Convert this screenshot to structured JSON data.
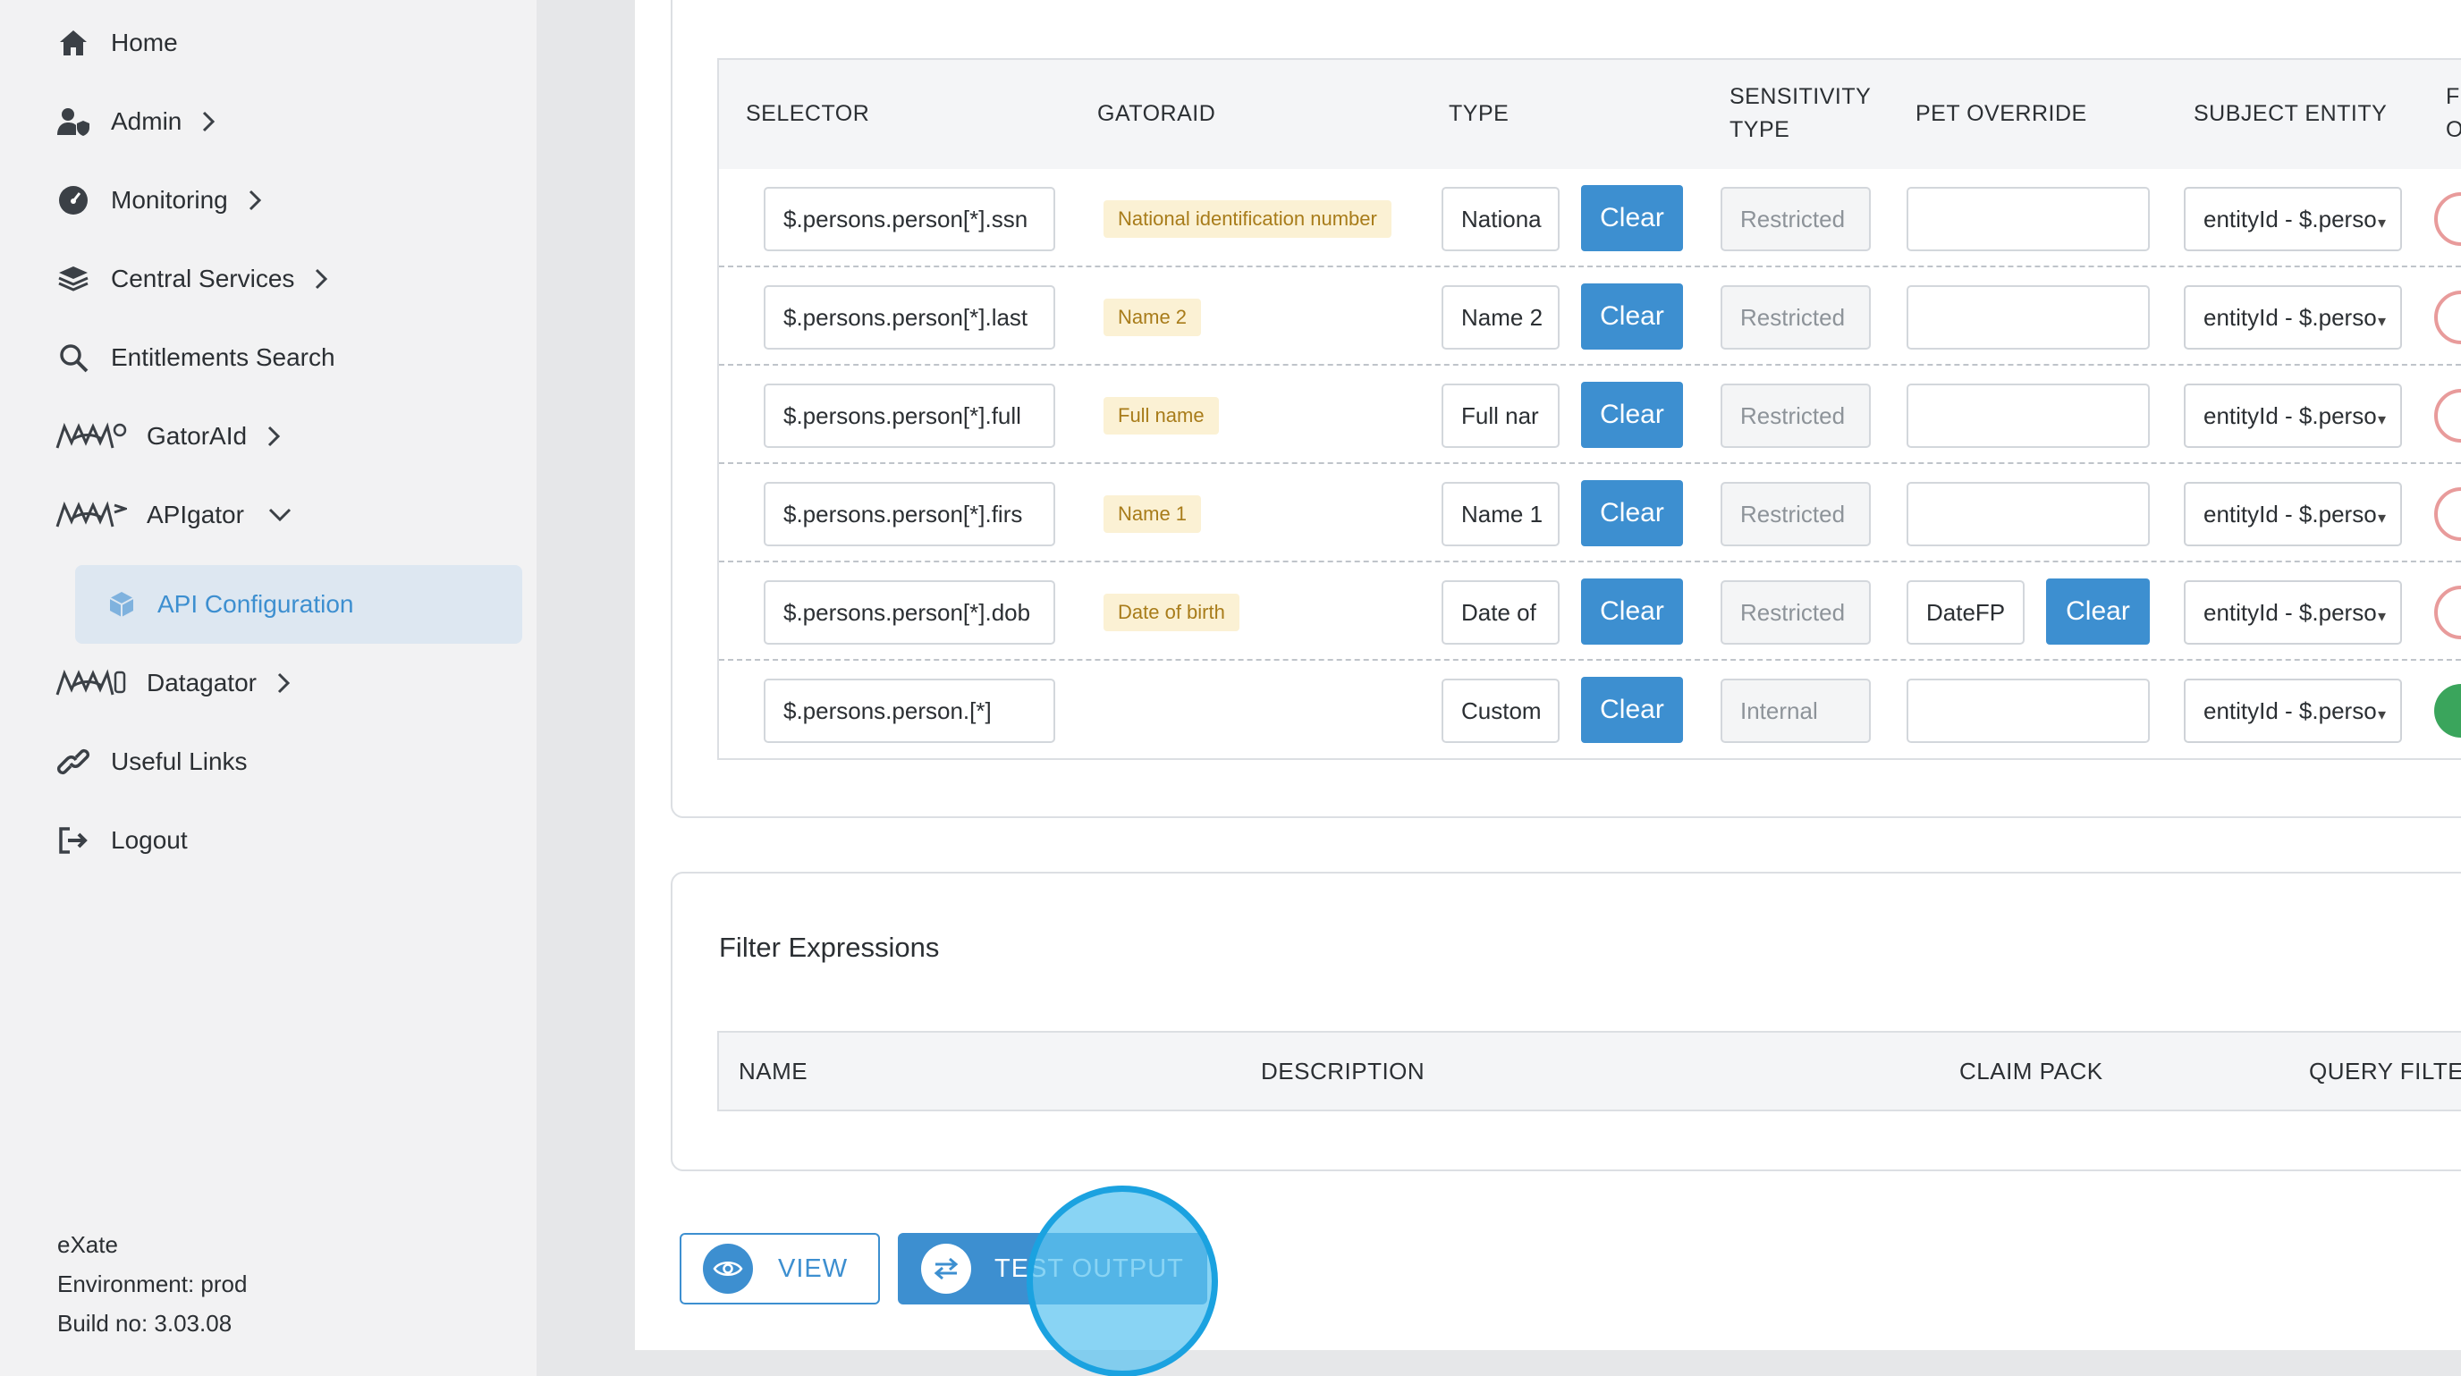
{
  "sidebar": {
    "items": [
      {
        "label": "Home",
        "icon": "home-icon"
      },
      {
        "label": "Admin",
        "icon": "user-shield-icon"
      },
      {
        "label": "Monitoring",
        "icon": "gauge-icon"
      },
      {
        "label": "Central Services",
        "icon": "layers-icon"
      },
      {
        "label": "Entitlements Search",
        "icon": "search-icon"
      },
      {
        "label": "GatorAId",
        "icon": "gator-icon"
      },
      {
        "label": "APIgator",
        "icon": "gator-icon"
      },
      {
        "label": "Datagator",
        "icon": "gator-icon"
      },
      {
        "label": "Useful Links",
        "icon": "link-icon"
      },
      {
        "label": "Logout",
        "icon": "logout-icon"
      }
    ],
    "active_sub_item": {
      "label": "API Configuration",
      "icon": "cube-icon"
    },
    "footer": {
      "company": "eXate",
      "environment": "Environment: prod",
      "build": "Build no: 3.03.08"
    }
  },
  "selectors_table": {
    "headers": {
      "selector": "SELECTOR",
      "gatoraid": "GATORAID",
      "type": "TYPE",
      "sensitivity_line1": "SENSITIVITY",
      "sensitivity_line2": "TYPE",
      "pet_override": "PET OVERRIDE",
      "subject_entity": "SUBJECT ENTITY",
      "cut_line1": "FI",
      "cut_line2": "O"
    },
    "clear_label": "Clear",
    "rows": [
      {
        "selector": "$.persons.person[*].ssn",
        "gatoraid": "National identification number",
        "type": "Nationa",
        "sensitivity": "Restricted",
        "pet": "",
        "subject": "entityId - $.perso"
      },
      {
        "selector": "$.persons.person[*].last",
        "gatoraid": "Name 2",
        "type": "Name 2",
        "sensitivity": "Restricted",
        "pet": "",
        "subject": "entityId - $.perso"
      },
      {
        "selector": "$.persons.person[*].full",
        "gatoraid": "Full name",
        "type": "Full nar",
        "sensitivity": "Restricted",
        "pet": "",
        "subject": "entityId - $.perso"
      },
      {
        "selector": "$.persons.person[*].firs",
        "gatoraid": "Name 1",
        "type": "Name 1",
        "sensitivity": "Restricted",
        "pet": "",
        "subject": "entityId - $.perso"
      },
      {
        "selector": "$.persons.person[*].dob",
        "gatoraid": "Date of birth",
        "type": "Date of",
        "sensitivity": "Restricted",
        "pet": "DateFP",
        "subject": "entityId - $.perso"
      },
      {
        "selector": "$.persons.person.[*]",
        "gatoraid": "",
        "type": "Custom",
        "sensitivity": "Internal",
        "pet": "",
        "subject": "entityId - $.perso"
      }
    ]
  },
  "filter_expressions": {
    "title": "Filter Expressions",
    "headers": {
      "name": "NAME",
      "description": "DESCRIPTION",
      "claim_pack": "CLAIM PACK",
      "query_filter": "QUERY FILTER"
    }
  },
  "actions": {
    "view_label": "VIEW",
    "test_output_label": "TEST OUTPUT"
  },
  "colors": {
    "accent": "#3d8fd0",
    "tag_bg": "#fbf1d4",
    "tag_text": "#a87c1a",
    "status_off": "#e89b9b",
    "status_on": "#3aa55c",
    "click_highlight": "#1ba2e0"
  }
}
